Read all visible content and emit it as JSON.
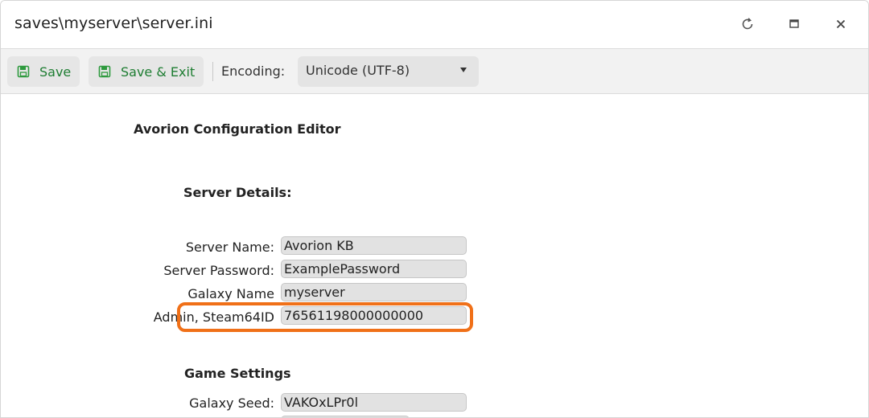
{
  "window": {
    "title": "saves\\myserver\\server.ini"
  },
  "toolbar": {
    "save_label": "Save",
    "save_exit_label": "Save & Exit",
    "encoding_label": "Encoding:",
    "encoding_value": "Unicode (UTF-8)"
  },
  "editor": {
    "title": "Avorion Configuration Editor",
    "server_section": {
      "heading": "Server Details:",
      "fields": [
        {
          "label": "Server Name:",
          "value": "Avorion KB"
        },
        {
          "label": "Server Password:",
          "value": "ExamplePassword"
        },
        {
          "label": "Galaxy Name",
          "value": "myserver"
        },
        {
          "label": "Admin, Steam64ID",
          "value": "76561198000000000"
        }
      ]
    },
    "game_section": {
      "heading": "Game Settings",
      "fields": [
        {
          "label": "Galaxy Seed:",
          "value": "VAKOxLPr0l"
        }
      ]
    }
  },
  "colors": {
    "accent_green": "#1e7d32",
    "highlight_orange": "#f07018"
  }
}
